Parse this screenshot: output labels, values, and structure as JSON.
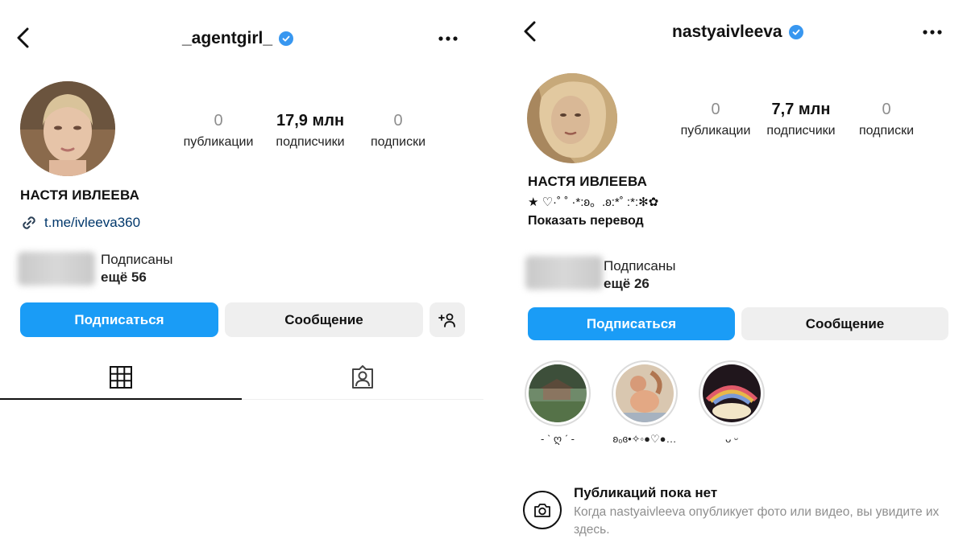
{
  "left": {
    "username": "_agentgirl_",
    "stats": [
      {
        "value": "0",
        "label": "публикации"
      },
      {
        "value": "17,9 млн",
        "label": "подписчики"
      },
      {
        "value": "0",
        "label": "подписки"
      }
    ],
    "name": "НАСТЯ ИВЛЕЕВА",
    "link": "t.me/ivleeva360",
    "followed_by_line1": "Подписаны",
    "followed_by_line2": "ещё 56",
    "follow_label": "Подписаться",
    "message_label": "Сообщение",
    "active_tab": "grid"
  },
  "right": {
    "username": "nastyaivleeva",
    "stats": [
      {
        "value": "0",
        "label": "публикации"
      },
      {
        "value": "7,7 млн",
        "label": "подписчики"
      },
      {
        "value": "0",
        "label": "подписки"
      }
    ],
    "name": "НАСТЯ ИВЛЕЕВА",
    "bio": "★ ♡·˚ ˚ ·*:ʚ。.ʚ:*˚ :*:✻✿",
    "translate_label": "Показать перевод",
    "followed_by_line1": "Подписаны",
    "followed_by_line2": "ещё 26",
    "follow_label": "Подписаться",
    "message_label": "Сообщение",
    "highlights": [
      {
        "label": "- ˋ ღ ˊ -"
      },
      {
        "label": "ʚ₀ɞ•✧◦●♡●…"
      },
      {
        "label": "ᴗ ᵕ"
      }
    ],
    "empty_title": "Публикаций пока нет",
    "empty_text": "Когда nastyaivleeva опубликует фото или видео, вы увидите их здесь."
  },
  "colors": {
    "primary_button": "#1a9cf6",
    "secondary_button": "#efefef",
    "verified_badge": "#3897f0",
    "link_text": "#00376b"
  }
}
